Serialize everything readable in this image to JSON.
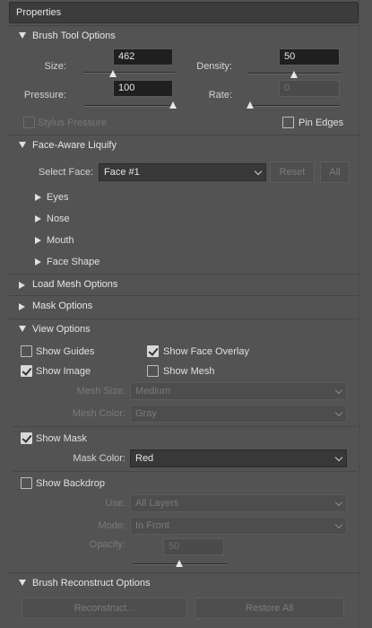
{
  "panel": {
    "title": "Properties"
  },
  "brush_tool": {
    "header": "Brush Tool Options",
    "size_label": "Size:",
    "size_value": "462",
    "density_label": "Density:",
    "density_value": "50",
    "pressure_label": "Pressure:",
    "pressure_value": "100",
    "rate_label": "Rate:",
    "rate_value": "0",
    "stylus_label": "Stylus Pressure",
    "stylus_checked": false,
    "pin_edges_label": "Pin Edges",
    "pin_edges_checked": false
  },
  "face_aware": {
    "header": "Face-Aware Liquify",
    "select_face_label": "Select Face:",
    "select_face_value": "Face #1",
    "reset_label": "Reset",
    "all_label": "All",
    "items": [
      {
        "label": "Eyes"
      },
      {
        "label": "Nose"
      },
      {
        "label": "Mouth"
      },
      {
        "label": "Face Shape"
      }
    ]
  },
  "load_mesh": {
    "header": "Load Mesh Options"
  },
  "mask_options": {
    "header": "Mask Options"
  },
  "view_options": {
    "header": "View Options",
    "show_guides_label": "Show Guides",
    "show_guides_checked": false,
    "show_face_overlay_label": "Show Face Overlay",
    "show_face_overlay_checked": true,
    "show_image_label": "Show Image",
    "show_image_checked": true,
    "show_mesh_label": "Show Mesh",
    "show_mesh_checked": false,
    "mesh_size_label": "Mesh Size:",
    "mesh_size_value": "Medium",
    "mesh_color_label": "Mesh Color:",
    "mesh_color_value": "Gray",
    "show_mask_label": "Show Mask",
    "show_mask_checked": true,
    "mask_color_label": "Mask Color:",
    "mask_color_value": "Red",
    "show_backdrop_label": "Show Backdrop",
    "show_backdrop_checked": false,
    "use_label": "Use:",
    "use_value": "All Layers",
    "mode_label": "Mode:",
    "mode_value": "In Front",
    "opacity_label": "Opacity:",
    "opacity_value": "50"
  },
  "reconstruct": {
    "header": "Brush Reconstruct Options",
    "reconstruct_label": "Reconstruct...",
    "restore_all_label": "Restore All"
  }
}
